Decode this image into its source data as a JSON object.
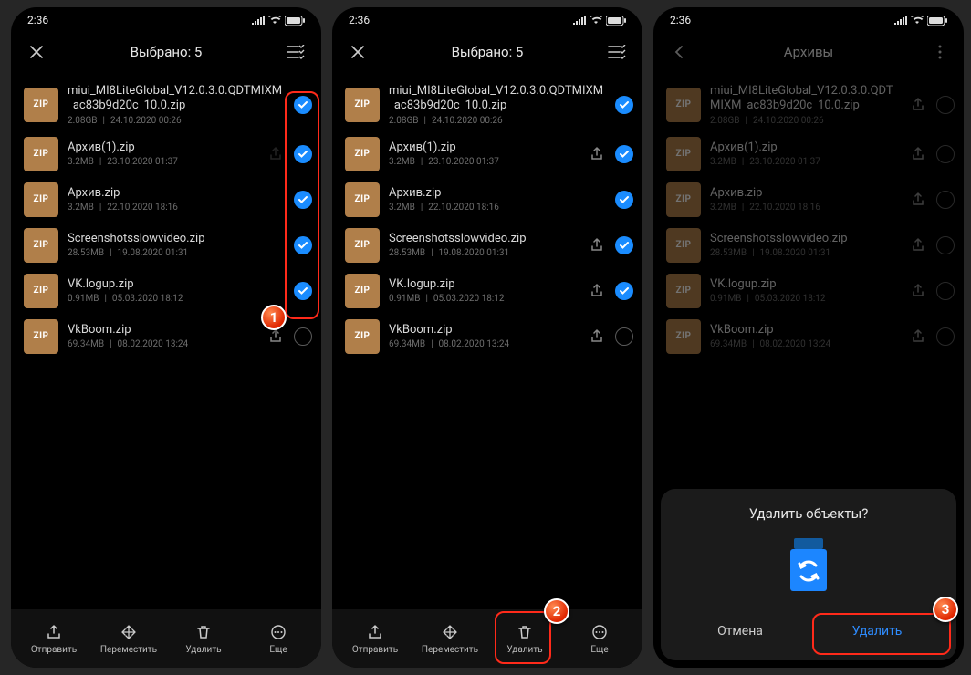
{
  "status": {
    "time": "2:36"
  },
  "zip_badge_text": "ZIP",
  "phone1": {
    "title": "Выбрано: 5",
    "files": [
      {
        "name": "miui_MI8LiteGlobal_V12.0.3.0.QDTMIXM_ac83b9d20c_10.0.zip",
        "size": "2.08GB",
        "date": "24.10.2020 00:26",
        "checked": true
      },
      {
        "name": "Архив(1).zip",
        "size": "3.2MB",
        "date": "23.10.2020 01:37",
        "checked": true
      },
      {
        "name": "Архив.zip",
        "size": "3.2MB",
        "date": "22.10.2020 18:16",
        "checked": true
      },
      {
        "name": "Screenshotsslowvideo.zip",
        "size": "28.53MB",
        "date": "19.08.2020 01:31",
        "checked": true
      },
      {
        "name": "VK.logup.zip",
        "size": "0.91MB",
        "date": "05.03.2020 18:12",
        "checked": true
      },
      {
        "name": "VkBoom.zip",
        "size": "69.34MB",
        "date": "08.02.2020 13:24",
        "checked": false
      }
    ],
    "actions": {
      "send": "Отправить",
      "move": "Переместить",
      "delete": "Удалить",
      "more": "Еще"
    }
  },
  "phone2": {
    "title": "Выбрано: 5",
    "files": [
      {
        "name": "miui_MI8LiteGlobal_V12.0.3.0.QDTMIXM_ac83b9d20c_10.0.zip",
        "size": "2.08GB",
        "date": "24.10.2020 00:26",
        "checked": true
      },
      {
        "name": "Архив(1).zip",
        "size": "3.2MB",
        "date": "23.10.2020 01:37",
        "checked": true
      },
      {
        "name": "Архив.zip",
        "size": "3.2MB",
        "date": "22.10.2020 18:16",
        "checked": true
      },
      {
        "name": "Screenshotsslowvideo.zip",
        "size": "28.53MB",
        "date": "19.08.2020 01:31",
        "checked": true
      },
      {
        "name": "VK.logup.zip",
        "size": "0.91MB",
        "date": "05.03.2020 18:12",
        "checked": true
      },
      {
        "name": "VkBoom.zip",
        "size": "69.34MB",
        "date": "08.02.2020 13:24",
        "checked": false
      }
    ],
    "actions": {
      "send": "Отправить",
      "move": "Переместить",
      "delete": "Удалить",
      "more": "Еще"
    }
  },
  "phone3": {
    "title": "Архивы",
    "files": [
      {
        "name": "miui_MI8LiteGlobal_V12.0.3.0.QDTMIXM_ac83b9d20c_10.0.zip",
        "size": "2.08GB",
        "date": "24.10.2020 00:26"
      },
      {
        "name": "Архив(1).zip",
        "size": "3.2MB",
        "date": "23.10.2020 01:37"
      },
      {
        "name": "Архив.zip",
        "size": "3.2MB",
        "date": "22.10.2020 18:16"
      },
      {
        "name": "Screenshotsslowvideo.zip",
        "size": "28.53MB",
        "date": "19.08.2020 01:31"
      },
      {
        "name": "VK.logup.zip",
        "size": "0.91MB",
        "date": "05.03.2020 18:12"
      },
      {
        "name": "VkBoom.zip",
        "size": "69.34MB",
        "date": "08.02.2020 13:24"
      }
    ],
    "dialog": {
      "title": "Удалить объекты?",
      "cancel": "Отмена",
      "delete": "Удалить"
    }
  },
  "annotations": {
    "b1": "1",
    "b2": "2",
    "b3": "3"
  }
}
